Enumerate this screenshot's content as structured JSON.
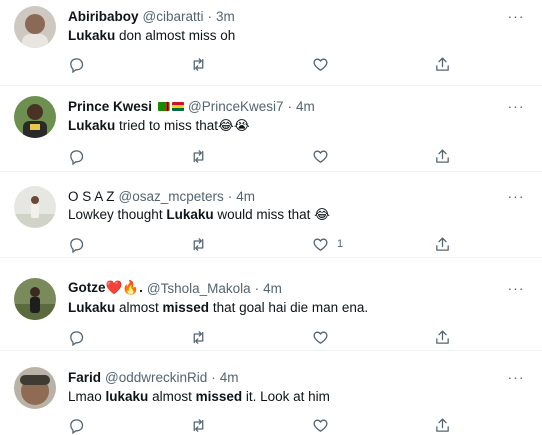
{
  "tweets": [
    {
      "name": "Abiribaboy",
      "handle": "@cibaratti",
      "sep": "·",
      "time": "3m",
      "text_parts": [
        {
          "b": "Lukaku"
        },
        {
          "t": " don almost miss oh"
        }
      ],
      "like_count": ""
    },
    {
      "name": "Prince Kwesi",
      "handle": "@PrinceKwesi7",
      "sep": "·",
      "time": "4m",
      "text_parts": [
        {
          "b": "Lukaku"
        },
        {
          "t": " tried to miss that😂😭"
        }
      ],
      "like_count": ""
    },
    {
      "name": "O S A Z",
      "handle": "@osaz_mcpeters",
      "sep": "·",
      "time": "4m",
      "text_parts": [
        {
          "t": "Lowkey thought "
        },
        {
          "b": "Lukaku"
        },
        {
          "t": " would miss that 😂"
        }
      ],
      "like_count": "1"
    },
    {
      "name": "Gotze❤️🔥.",
      "handle": "@Tshola_Makola",
      "sep": "·",
      "time": "4m",
      "text_parts": [
        {
          "b": "Lukaku"
        },
        {
          "t": " almost "
        },
        {
          "b": "missed"
        },
        {
          "t": " that goal hai die man ena."
        }
      ],
      "like_count": ""
    },
    {
      "name": "Farid",
      "handle": "@oddwreckinRid",
      "sep": "·",
      "time": "4m",
      "text_parts": [
        {
          "t": "Lmao "
        },
        {
          "b": "lukaku"
        },
        {
          "t": " almost "
        },
        {
          "b": "missed"
        },
        {
          "t": " it. Look at him"
        }
      ],
      "like_count": ""
    }
  ],
  "more_label": "···",
  "icons": {
    "reply": "reply-icon",
    "retweet": "retweet-icon",
    "like": "like-icon",
    "share": "share-icon",
    "more": "more-icon"
  },
  "colors": {
    "text": "#0f1419",
    "secondary": "#536471",
    "divider": "#eff3f4"
  }
}
